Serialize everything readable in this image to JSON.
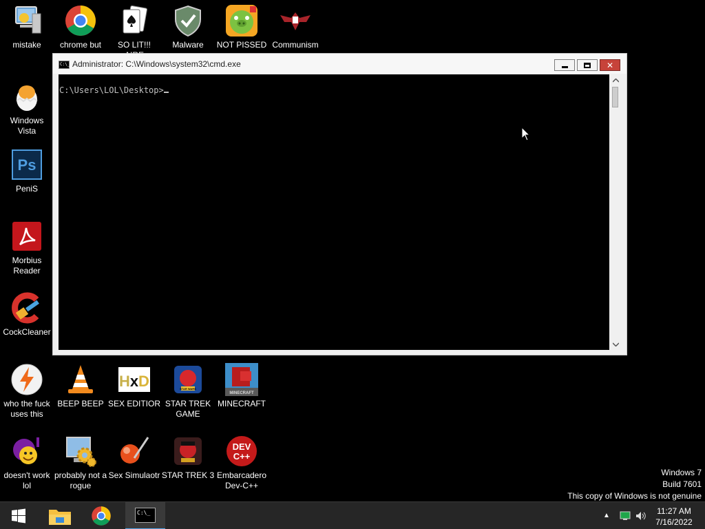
{
  "desktop": {
    "icons": [
      {
        "label": "mistake"
      },
      {
        "label": "chrome but"
      },
      {
        "label": "SO LIT!!! AIRE"
      },
      {
        "label": "Malware"
      },
      {
        "label": "NOT PISSED"
      },
      {
        "label": "Communism"
      },
      {
        "label": "Windows Vista"
      },
      {
        "label": "PeniS"
      },
      {
        "label": "Morbius Reader"
      },
      {
        "label": "CockCleaner"
      },
      {
        "label": "who the fuck uses this"
      },
      {
        "label": "BEEP BEEP"
      },
      {
        "label": "SEX EDITIOR"
      },
      {
        "label": "STAR TREK GAME"
      },
      {
        "label": "MINECRAFT"
      },
      {
        "label": "doesn't work lol"
      },
      {
        "label": "probably not a rogue"
      },
      {
        "label": "Sex Simulaotr"
      },
      {
        "label": "STAR TREK 3"
      },
      {
        "label": "Embarcadero Dev-C++"
      }
    ],
    "icon_glyphs": {
      "ps": "Ps",
      "hxd_h": "H",
      "hxd_x": "x",
      "hxd_d": "D",
      "devcpp_line1": "DEV",
      "devcpp_line2": "C++",
      "star_wars": "STAR WARS",
      "minecraft": "MINECRAFT"
    }
  },
  "cmd_window": {
    "title": "Administrator: C:\\Windows\\system32\\cmd.exe",
    "icon_text": "C:\\_",
    "prompt": "C:\\Users\\LOL\\Desktop>",
    "close_glyph": "✕"
  },
  "watermark": {
    "line1": "Windows 7",
    "line2": "Build 7601",
    "line3": "This copy of Windows is not genuine"
  },
  "taskbar": {
    "cmd_icon_text": "C:\\_",
    "tray_arrow": "▲",
    "time": "11:27 AM",
    "date": "7/16/2022"
  },
  "colors": {
    "desktop_bg": "#000000",
    "taskbar_bg": "#262626",
    "close_button": "#c7433a",
    "console_text": "#c0c0c0"
  }
}
